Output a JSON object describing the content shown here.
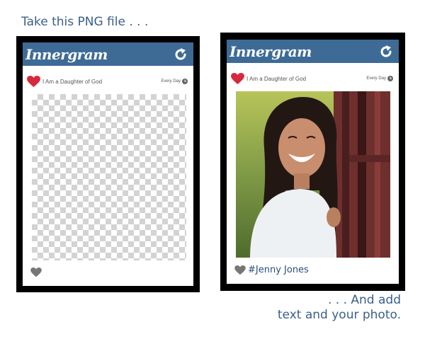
{
  "captions": {
    "top": "Take this PNG file . . .",
    "bottom_line1": ". . . And add",
    "bottom_line2": "text and your photo."
  },
  "app": {
    "logo": "Innergram",
    "refresh_icon": "refresh-icon"
  },
  "post": {
    "title": "I Am a Daughter of God",
    "time_label": "Every Day",
    "heart_icon": "heart-icon",
    "clock_icon": "clock-icon"
  },
  "filled": {
    "hashtag": "#Jenny Jones"
  },
  "colors": {
    "brand_bar": "#3e6b96",
    "heart": "#d8283d",
    "caption": "#3b5f8a",
    "frame": "#000000"
  }
}
